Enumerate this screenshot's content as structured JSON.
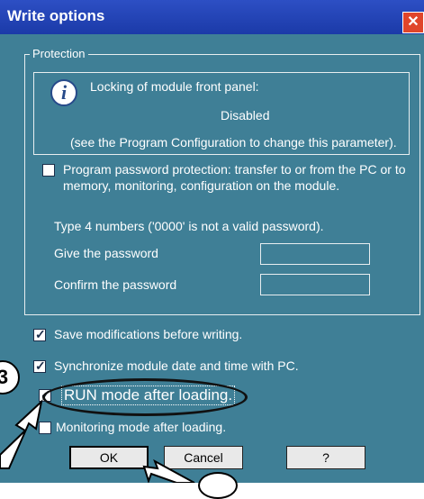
{
  "window": {
    "title": "Write options",
    "close_symbol": "✕"
  },
  "protection": {
    "group_label": "Protection",
    "locking_label": "Locking of module front panel:",
    "locking_value": "Disabled",
    "locking_note": "(see the Program Configuration to change this parameter).",
    "password_protection_line1": "Program password protection: transfer to or from the PC or to",
    "password_protection_line2": "memory, monitoring, configuration on the module.",
    "password_hint": "Type 4 numbers ('0000' is not a valid password).",
    "give_password_label": "Give the password",
    "confirm_password_label": "Confirm the password",
    "give_password_value": "",
    "confirm_password_value": ""
  },
  "options": {
    "save_modifications": "Save modifications before writing.",
    "synchronize": "Synchronize module date and time with PC.",
    "run_mode": "RUN mode after loading.",
    "monitoring_mode": "Monitoring mode after loading."
  },
  "buttons": {
    "ok": "OK",
    "cancel": "Cancel",
    "help": "?"
  },
  "annotations": {
    "step_left": "3",
    "step_bottom": ""
  }
}
